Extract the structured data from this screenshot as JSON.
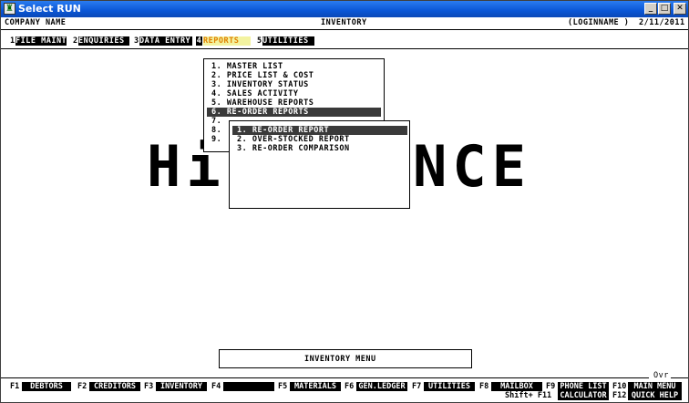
{
  "window": {
    "title": "Select RUN"
  },
  "header": {
    "company": "COMPANY NAME",
    "module": "INVENTORY",
    "login": "(LOGINNAME )",
    "date": "2/11/2011"
  },
  "menubar": [
    {
      "num": "1",
      "label": "FILE MAINT"
    },
    {
      "num": "2",
      "label": "ENQUIRIES"
    },
    {
      "num": "3",
      "label": "DATA ENTRY"
    },
    {
      "num": "4",
      "label": "REPORTS"
    },
    {
      "num": "5",
      "label": "UTILITIES"
    }
  ],
  "reports_menu": [
    "1. MASTER LIST",
    "2. PRICE LIST & COST",
    "3. INVENTORY STATUS",
    "4. SALES ACTIVITY",
    "5. WAREHOUSE REPORTS",
    "6. RE-ORDER REPORTS",
    "7.",
    "8.",
    "9."
  ],
  "reorder_submenu": [
    "1. RE-ORDER REPORT",
    "2. OVER-STOCKED REPORT",
    "3. RE-ORDER COMPARISON"
  ],
  "background_logo": {
    "left": "Hi",
    "right": "NCE"
  },
  "status": {
    "menu_name": "INVENTORY MENU",
    "mode": "Ovr"
  },
  "fkeys_row1": [
    {
      "key": "F1",
      "label": "DEBTORS"
    },
    {
      "key": "F2",
      "label": "CREDITORS"
    },
    {
      "key": "F3",
      "label": "INVENTORY"
    },
    {
      "key": "F4",
      "label": ""
    },
    {
      "key": "F5",
      "label": "MATERIALS"
    },
    {
      "key": "F6",
      "label": "GEN.LEDGER"
    },
    {
      "key": "F7",
      "label": "UTILITIES"
    },
    {
      "key": "F8",
      "label": "MAILBOX"
    },
    {
      "key": "F9",
      "label": "PHONE LIST"
    },
    {
      "key": "F10",
      "label": "MAIN MENU"
    }
  ],
  "fkeys_row2": [
    {
      "key": "Shift+ F11",
      "label": "CALCULATOR"
    },
    {
      "key": "F12",
      "label": "QUICK HELP"
    }
  ]
}
